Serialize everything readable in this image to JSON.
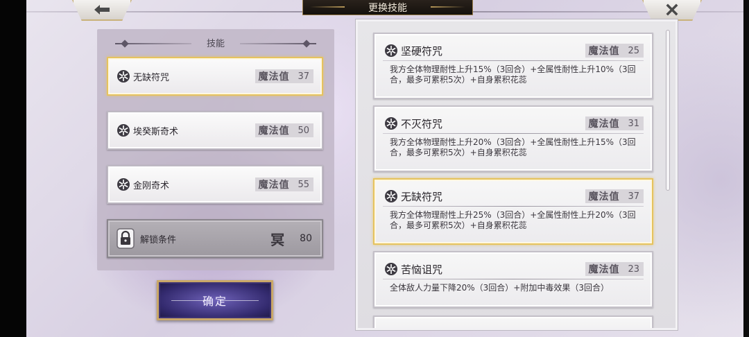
{
  "header": {
    "title": "更换技能",
    "back_icon": "back-arrow-icon",
    "close_icon": "close-icon"
  },
  "left_panel": {
    "header": "技能",
    "slots": [
      {
        "name": "无缺符咒",
        "mana_label": "魔法值",
        "mana": "37",
        "selected": true
      },
      {
        "name": "埃癸斯奇术",
        "mana_label": "魔法值",
        "mana": "50",
        "selected": false
      },
      {
        "name": "金刚奇术",
        "mana_label": "魔法值",
        "mana": "55",
        "selected": false
      }
    ],
    "locked_slot": {
      "name": "解锁条件",
      "glyph": "冥",
      "value": "80"
    },
    "confirm_label": "确定"
  },
  "skill_list": {
    "cards": [
      {
        "name": "坚硬符咒",
        "mana_label": "魔法值",
        "mana": "25",
        "desc": "我方全体物理耐性上升15%（3回合）+全属性耐性上升10%（3回合，最多可累积5次）+自身累积花蕊",
        "selected": false
      },
      {
        "name": "不灭符咒",
        "mana_label": "魔法值",
        "mana": "31",
        "desc": "我方全体物理耐性上升20%（3回合）+全属性耐性上升15%（3回合，最多可累积5次）+自身累积花蕊",
        "selected": false
      },
      {
        "name": "无缺符咒",
        "mana_label": "魔法值",
        "mana": "37",
        "desc": "我方全体物理耐性上升25%（3回合）+全属性耐性上升20%（3回合，最多可累积5次）+自身累积花蕊",
        "selected": true
      },
      {
        "name": "苦恼诅咒",
        "mana_label": "魔法值",
        "mana": "23",
        "desc": "全体敌人力量下降20%（3回合）+附加中毒效果（3回合）",
        "selected": false
      }
    ]
  },
  "colors": {
    "selected_border": "#e6c35e",
    "confirm_button": "#332a6e",
    "title_plate": "#1f1913"
  }
}
